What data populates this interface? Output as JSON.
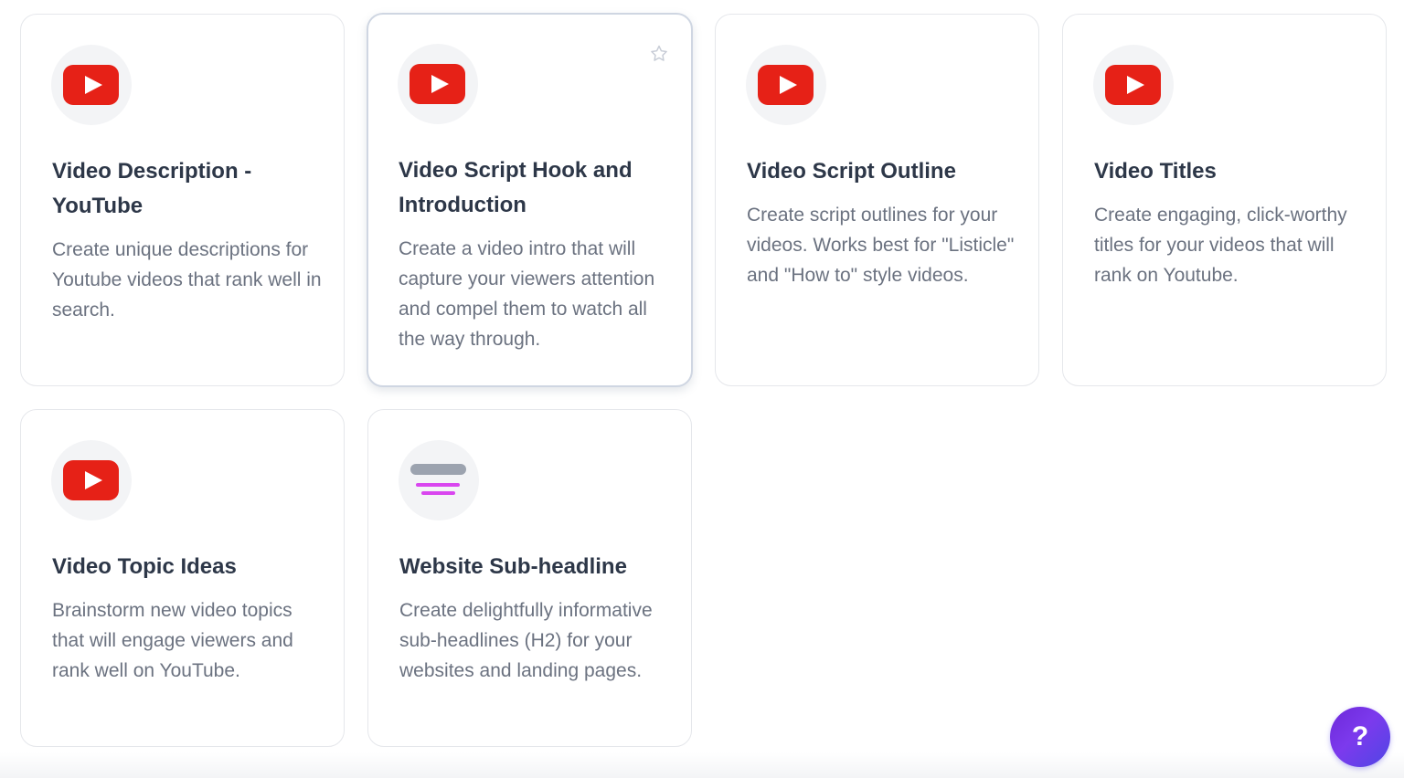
{
  "cards": [
    {
      "title": "Video Description - YouTube",
      "description": "Create unique descriptions for Youtube videos that rank well in search.",
      "icon": "youtube-icon"
    },
    {
      "title": "Video Script Hook and Introduction",
      "description": "Create a video intro that will capture your viewers attention and compel them to watch all the way through.",
      "icon": "youtube-icon",
      "favorite_icon": "star-outline-icon"
    },
    {
      "title": "Video Script Outline",
      "description": "Create script outlines for your videos. Works best for \"Listicle\" and \"How to\" style videos.",
      "icon": "youtube-icon"
    },
    {
      "title": "Video Titles",
      "description": "Create engaging, click-worthy titles for your videos that will rank on Youtube.",
      "icon": "youtube-icon"
    },
    {
      "title": "Video Topic Ideas",
      "description": "Brainstorm new video topics that will engage viewers and rank well on YouTube.",
      "icon": "youtube-icon"
    },
    {
      "title": "Website Sub-headline",
      "description": "Create delightfully informative sub-headlines (H2) for your websites and landing pages.",
      "icon": "subheadline-icon"
    }
  ],
  "help_button": {
    "label": "?",
    "icon": "help-icon"
  },
  "colors": {
    "youtube_red": "#e62117",
    "title_text": "#2d3748",
    "description_text": "#6b7280",
    "card_border": "#e5e7eb",
    "subheadline_accent": "#d946ef",
    "help_button": "#7c3aed"
  }
}
